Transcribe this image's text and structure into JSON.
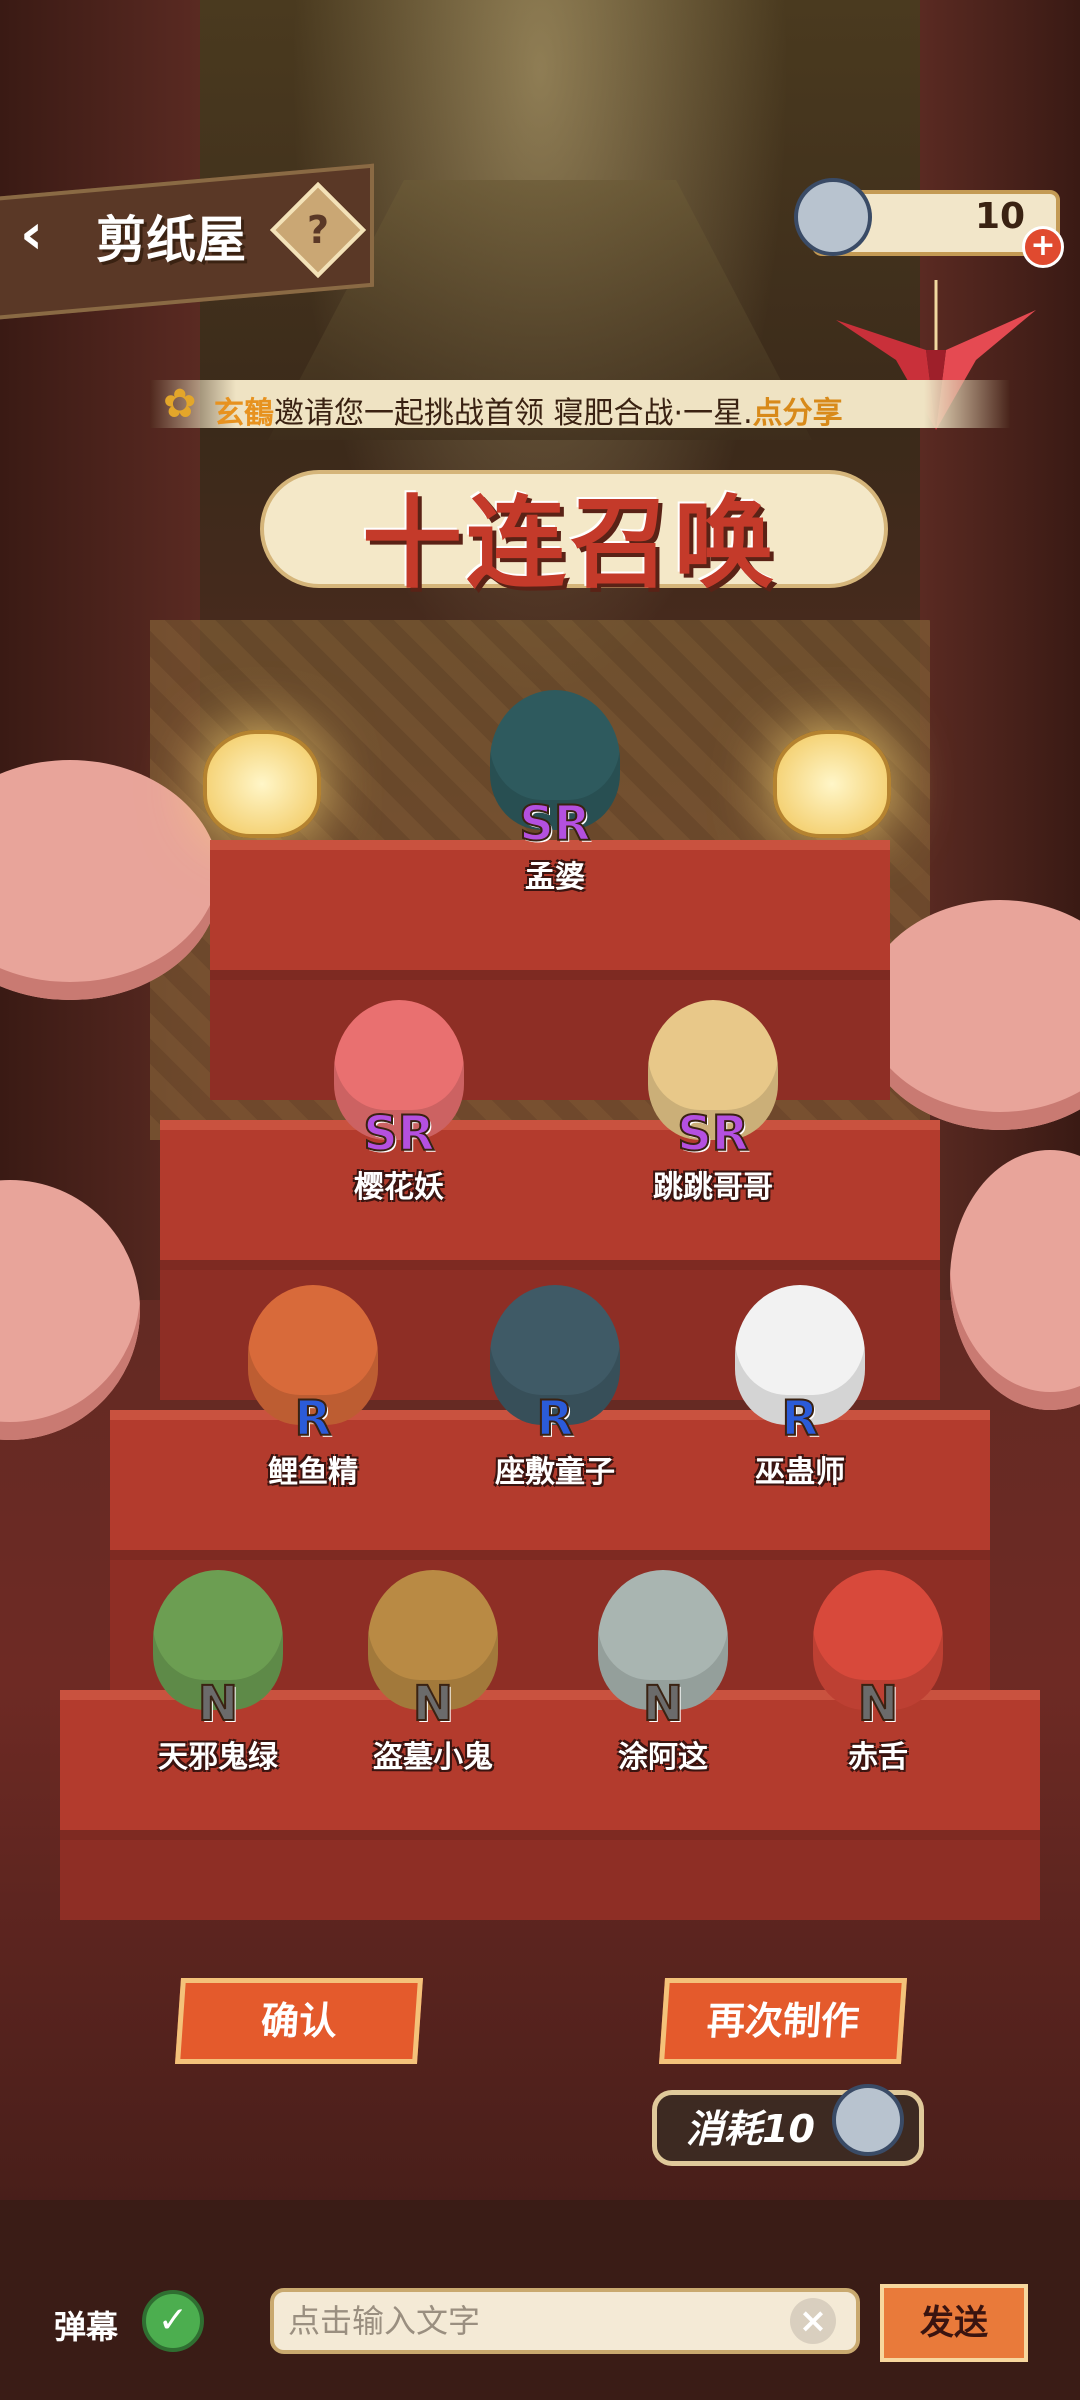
{
  "header": {
    "title": "剪纸屋",
    "help_icon": "question-icon",
    "currency_value": "10"
  },
  "notice": {
    "name": "玄鶴",
    "text": "邀请您一起挑战首领 寝肥合战·一星.",
    "share": "点分享"
  },
  "banner_title": "十连召唤",
  "characters": [
    {
      "rarity": "SR",
      "name": "孟婆",
      "color": "#2e5a5e"
    },
    {
      "rarity": "SR",
      "name": "樱花妖",
      "color": "#e97070"
    },
    {
      "rarity": "SR",
      "name": "跳跳哥哥",
      "color": "#e8c889"
    },
    {
      "rarity": "R",
      "name": "鲤鱼精",
      "color": "#d86a3a"
    },
    {
      "rarity": "R",
      "name": "座敷童子",
      "color": "#3f5a66"
    },
    {
      "rarity": "R",
      "name": "巫蛊师",
      "color": "#f2f2f2"
    },
    {
      "rarity": "N",
      "name": "天邪鬼绿",
      "color": "#6c9e52"
    },
    {
      "rarity": "N",
      "name": "盗墓小鬼",
      "color": "#b98a44"
    },
    {
      "rarity": "N",
      "name": "涂阿这",
      "color": "#a9b5b1"
    },
    {
      "rarity": "N",
      "name": "赤舌",
      "color": "#d8493b"
    }
  ],
  "actions": {
    "confirm": "确认",
    "again": "再次制作",
    "cost": "消耗10"
  },
  "chat": {
    "danmaku_label": "弹幕",
    "placeholder": "点击输入文字",
    "send": "发送"
  }
}
